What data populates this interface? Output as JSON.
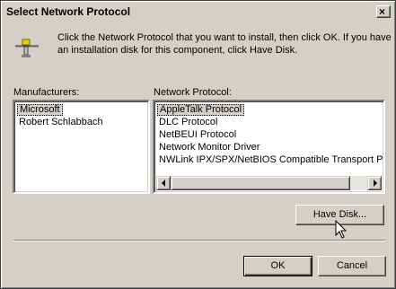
{
  "window": {
    "title": "Select Network Protocol",
    "close_glyph": "×",
    "icon": "network-protocol-icon"
  },
  "instruction": "Click the Network Protocol that you want to install, then click OK. If you have an installation disk for this component, click Have Disk.",
  "manufacturers": {
    "label": "Manufacturers:",
    "items": [
      "Microsoft",
      "Robert Schlabbach"
    ],
    "selected_index": 0
  },
  "protocols": {
    "label": "Network Protocol:",
    "items": [
      "AppleTalk Protocol",
      "DLC Protocol",
      "NetBEUI Protocol",
      "Network Monitor Driver",
      "NWLink IPX/SPX/NetBIOS Compatible Transport Pro"
    ],
    "selected_index": 0,
    "scroll_position": 0
  },
  "buttons": {
    "have_disk": "Have Disk...",
    "ok": "OK",
    "cancel": "Cancel"
  },
  "colors": {
    "face": "#d4d0c8",
    "shadow": "#808080",
    "highlight": "#ffffff"
  }
}
